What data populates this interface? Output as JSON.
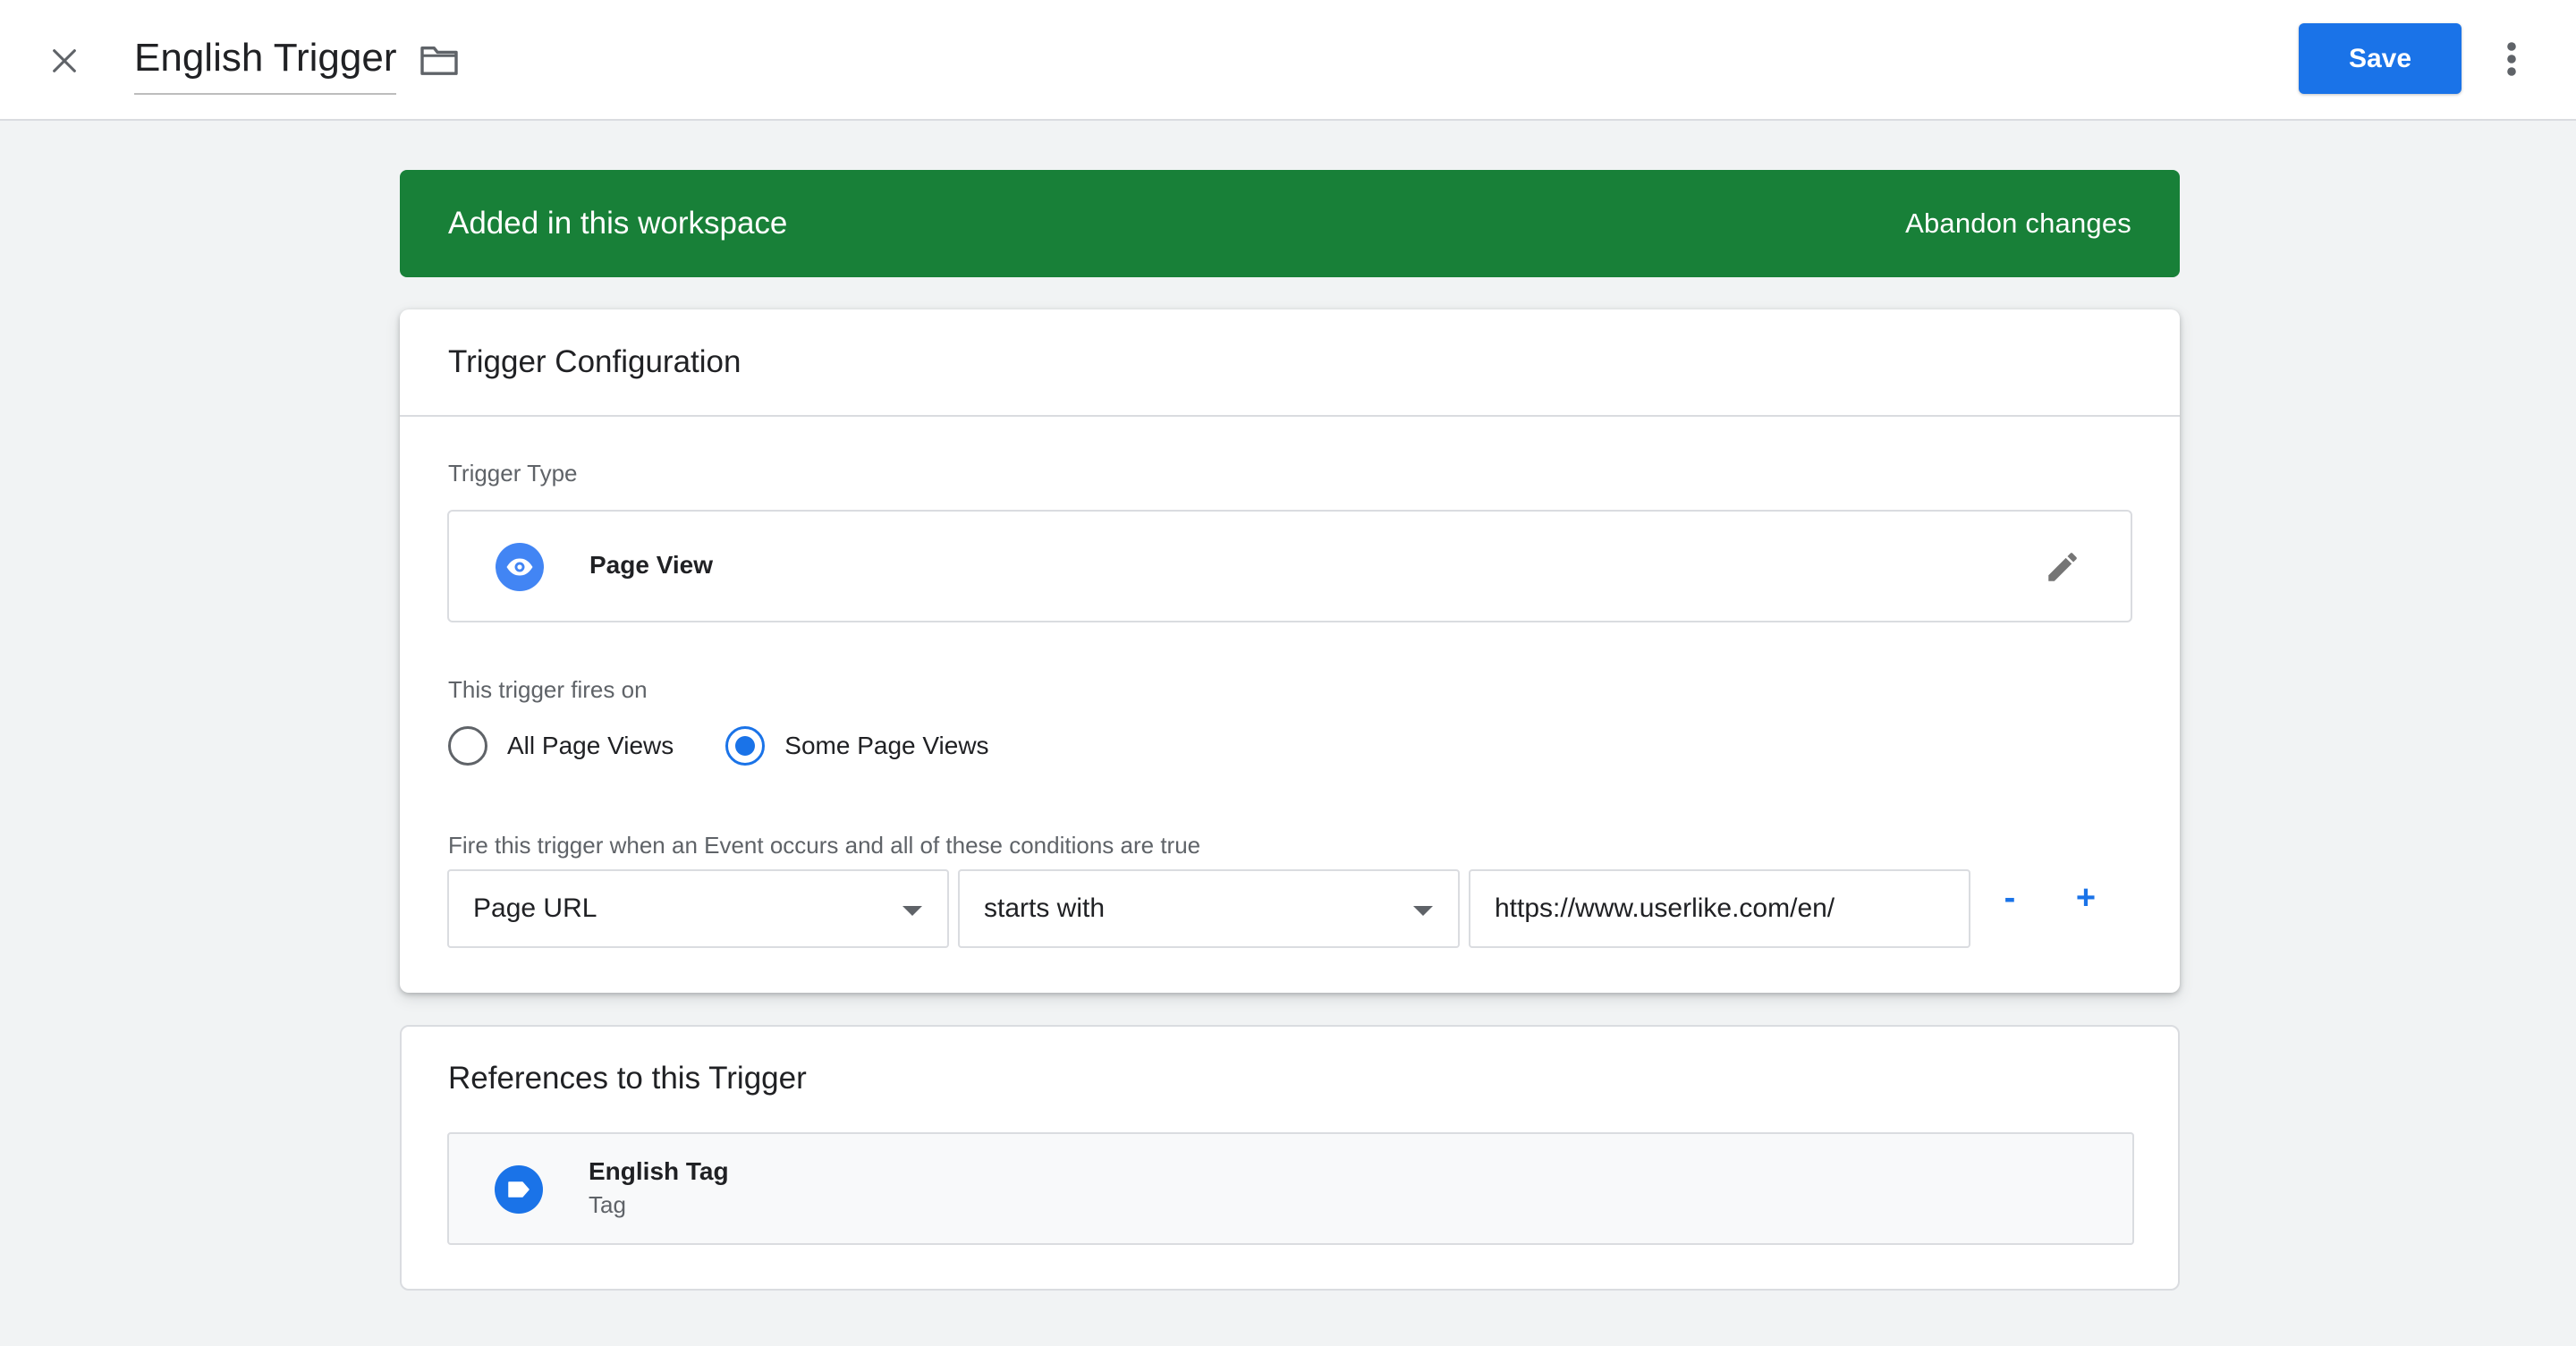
{
  "header": {
    "title": "English Trigger",
    "save_label": "Save"
  },
  "banner": {
    "text": "Added in this workspace",
    "action_label": "Abandon changes",
    "color": "#188038"
  },
  "config": {
    "title": "Trigger Configuration",
    "trigger_type_label": "Trigger Type",
    "trigger_type": {
      "name": "Page View",
      "icon": "eye-icon"
    },
    "fires_on_label": "This trigger fires on",
    "fires_on_options": [
      {
        "label": "All Page Views",
        "checked": false
      },
      {
        "label": "Some Page Views",
        "checked": true
      }
    ],
    "conditions_label": "Fire this trigger when an Event occurs and all of these conditions are true",
    "condition": {
      "variable": "Page URL",
      "operator": "starts with",
      "value": "https://www.userlike.com/en/"
    },
    "remove_label": "-",
    "add_label": "+"
  },
  "references": {
    "title": "References to this Trigger",
    "items": [
      {
        "name": "English Tag",
        "type": "Tag",
        "icon": "tag-icon"
      }
    ]
  },
  "colors": {
    "accent": "#1a73e8",
    "text": "#202124",
    "secondary_text": "#5f6368",
    "background": "#f1f3f4"
  }
}
